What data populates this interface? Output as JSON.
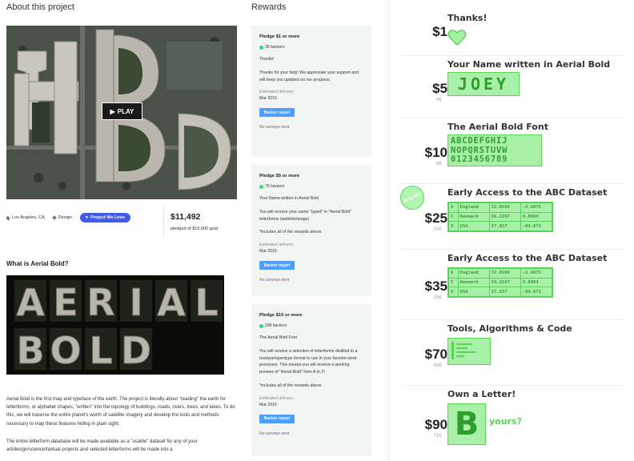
{
  "left": {
    "about_title": "About this project",
    "play_label": "PLAY",
    "location": "Los Angeles, CA",
    "category": "Design",
    "project_we_love": "Project We Love",
    "pledged_amount": "$11,492",
    "pledged_goal": "pledged of $10,000 goal",
    "what_title": "What is Aerial Bold?",
    "word_letters": [
      "A",
      "E",
      "R",
      "I",
      "A",
      "L",
      "B",
      "O",
      "L",
      "D"
    ],
    "desc_paragraph_1": "Aerial Bold is the first map and typeface of the earth. The project is literally about \"reading\" the earth for letterforms, or alphabet shapes, \"written\" into the topology of buildings, roads, rivers, trees, and lakes. To do this, we will traverse the entire planet's worth of satellite imagery and develop the tools and methods necessary to map these features hiding in plain sight.",
    "desc_paragraph_2": "The entire letterform database will be made available as a \"usable\" dataset for any of your art/design/science/textual projects and selected letterforms will be made into a"
  },
  "rewards": {
    "title": "Rewards",
    "cards": [
      {
        "pledge": "Pledge $1 or more",
        "backers": "36 backers",
        "paragraphs": [
          "Thanks!",
          "Thanks for your help! We appreciate your support and will keep you updated on our progress."
        ],
        "est_label": "Estimated delivery:",
        "est_date": "Mar 2015",
        "button": "Backer report",
        "surveys": "No surveys sent"
      },
      {
        "pledge": "Pledge $5 or more",
        "backers": "70 backers",
        "paragraphs": [
          "Your Name written in Aerial Bold",
          "You will receive your name \"typed\" in \"Aerial Bold\" letterforms (weblink/image)",
          "*includes all of the rewards above"
        ],
        "est_label": "Estimated delivery:",
        "est_date": "Mar 2015",
        "button": "Backer report",
        "surveys": "No surveys sent"
      },
      {
        "pledge": "Pledge $10 or more",
        "backers": "298 backers",
        "paragraphs": [
          "The Aerial Bold Font",
          "You will receive a selection of letterforms distilled to a truetype/opentype format to use in your favorite word processor. This means you will receive a working preview of \"Aerial Bold\" from A to Z!",
          "*includes all of the rewards above"
        ],
        "est_label": "Estimated delivery:",
        "est_date": "Mar 2015",
        "button": "Backer report",
        "surveys": "No surveys sent"
      }
    ]
  },
  "tiers": [
    {
      "price": "$1",
      "eur": "",
      "title": "Thanks!"
    },
    {
      "price": "$5",
      "eur": "4€",
      "title": "Your Name written in Aerial Bold",
      "name_sample": "JOEY"
    },
    {
      "price": "$10",
      "eur": "8€",
      "title": "The Aerial Bold Font",
      "font_rows": [
        "ABCDEFGHIJ",
        "NOPQRSTUVW",
        "0123456789"
      ]
    },
    {
      "price": "$25",
      "eur": "20€",
      "title": "Early Access to the ABC Dataset",
      "badge": "Early Bird"
    },
    {
      "price": "$35",
      "eur": "28€",
      "title": "Early Access to the ABC Dataset"
    },
    {
      "price": "$70",
      "eur": "56€",
      "title": "Tools, Algorithms & Code"
    },
    {
      "price": "$90",
      "eur": "71€",
      "title": "Own a Letter!",
      "letter_sample": "B",
      "letter_caption": "yours?"
    }
  ],
  "dataset_rows": [
    [
      "A",
      "England",
      "52.8584",
      "-2.6075"
    ],
    [
      "C",
      "Denmark",
      "56.2267",
      "9.8984"
    ],
    [
      "X",
      "USA",
      "37.037",
      "-94.673"
    ]
  ],
  "colors": {
    "accent_green": "#5bd35b",
    "light_green": "#a8f0a8",
    "backer_blue": "#4c9eff",
    "pwl_blue": "#3e5ce6"
  }
}
